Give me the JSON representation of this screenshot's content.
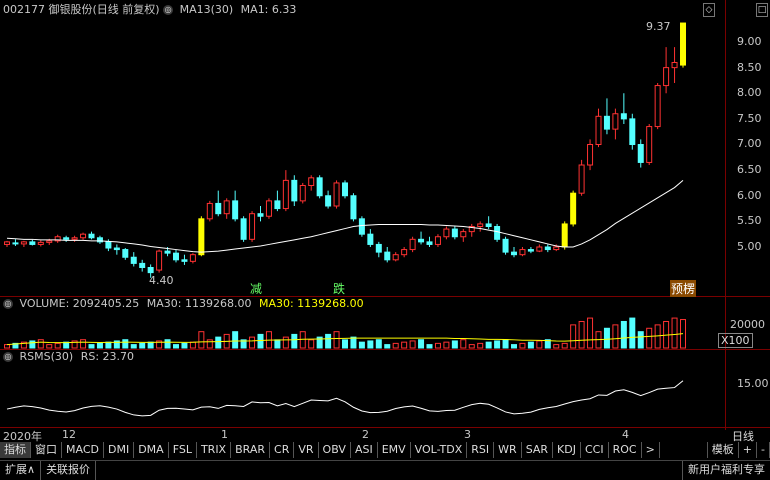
{
  "header": {
    "stock": "002177 御银股份(日线 前复权)",
    "ma_label": "MA13(30)",
    "ma_value": "MA1: 6.33",
    "volume_label": "VOLUME: 2092405.25",
    "ma30_a": "MA30: 1139268.00",
    "ma30_b": "MA30: 1139268.00",
    "rsms_label": "RSMS(30)",
    "rs_value": "RS: 23.70"
  },
  "price_axis": [
    "9.00",
    "8.50",
    "8.00",
    "7.50",
    "7.00",
    "6.50",
    "6.00",
    "5.50",
    "5.00"
  ],
  "volume_axis": {
    "tick": "20000",
    "unit": "X100"
  },
  "rsms_axis": {
    "tick": "15.00"
  },
  "annotations": {
    "high": "9.37",
    "low": "4.40",
    "tag1": "减",
    "tag2": "跌",
    "tag3": "预楞"
  },
  "date_axis": {
    "year": "2020年",
    "m12": "12",
    "m1": "1",
    "m2": "2",
    "m3": "3",
    "m4": "4",
    "period": "日线"
  },
  "tabs": [
    "指标",
    "窗口",
    "MACD",
    "DMI",
    "DMA",
    "FSL",
    "TRIX",
    "BRAR",
    "CR",
    "VR",
    "OBV",
    "ASI",
    "EMV",
    "VOL-TDX",
    "RSI",
    "WR",
    "SAR",
    "KDJ",
    "CCI",
    "ROC",
    ">",
    "模板",
    "+",
    "-"
  ],
  "bottom": {
    "expand": "扩展∧",
    "related": "关联报价",
    "promo": "新用户福利专享"
  },
  "colors": {
    "up": "#ff3232",
    "down": "#54ffff",
    "ma": "#ffffff",
    "accent": "#ffff00"
  },
  "chart_data": {
    "type": "candlestick",
    "title": "002177 御银股份(日线 前复权)",
    "ylim": [
      4.2,
      9.5
    ],
    "ohlc": [
      [
        5.05,
        5.12,
        5.0,
        5.1
      ],
      [
        5.08,
        5.15,
        5.02,
        5.06
      ],
      [
        5.06,
        5.12,
        5.0,
        5.1
      ],
      [
        5.1,
        5.14,
        5.03,
        5.05
      ],
      [
        5.05,
        5.13,
        5.01,
        5.09
      ],
      [
        5.09,
        5.16,
        5.04,
        5.12
      ],
      [
        5.12,
        5.24,
        5.08,
        5.2
      ],
      [
        5.18,
        5.22,
        5.1,
        5.15
      ],
      [
        5.15,
        5.22,
        5.1,
        5.18
      ],
      [
        5.18,
        5.28,
        5.14,
        5.25
      ],
      [
        5.25,
        5.3,
        5.15,
        5.18
      ],
      [
        5.18,
        5.22,
        5.06,
        5.1
      ],
      [
        5.1,
        5.15,
        4.92,
        4.98
      ],
      [
        4.98,
        5.05,
        4.85,
        4.95
      ],
      [
        4.95,
        4.98,
        4.75,
        4.8
      ],
      [
        4.8,
        4.9,
        4.62,
        4.68
      ],
      [
        4.68,
        4.75,
        4.52,
        4.6
      ],
      [
        4.6,
        4.66,
        4.4,
        4.5
      ],
      [
        4.55,
        4.95,
        4.5,
        4.92
      ],
      [
        4.92,
        5.0,
        4.82,
        4.88
      ],
      [
        4.88,
        4.95,
        4.7,
        4.75
      ],
      [
        4.75,
        4.85,
        4.65,
        4.72
      ],
      [
        4.72,
        4.88,
        4.68,
        4.85
      ],
      [
        4.85,
        5.6,
        4.82,
        5.55
      ],
      [
        5.55,
        5.9,
        5.5,
        5.85
      ],
      [
        5.85,
        6.1,
        5.6,
        5.65
      ],
      [
        5.65,
        5.95,
        5.55,
        5.9
      ],
      [
        5.9,
        6.1,
        5.5,
        5.55
      ],
      [
        5.55,
        5.6,
        5.1,
        5.15
      ],
      [
        5.15,
        5.7,
        5.1,
        5.65
      ],
      [
        5.65,
        5.8,
        5.5,
        5.6
      ],
      [
        5.6,
        5.95,
        5.55,
        5.9
      ],
      [
        5.9,
        6.1,
        5.7,
        5.75
      ],
      [
        5.75,
        6.5,
        5.7,
        6.3
      ],
      [
        6.3,
        6.4,
        5.8,
        5.9
      ],
      [
        5.9,
        6.25,
        5.85,
        6.2
      ],
      [
        6.2,
        6.4,
        6.1,
        6.35
      ],
      [
        6.35,
        6.4,
        5.95,
        6.0
      ],
      [
        6.0,
        6.1,
        5.75,
        5.8
      ],
      [
        5.8,
        6.3,
        5.75,
        6.25
      ],
      [
        6.25,
        6.3,
        5.95,
        6.0
      ],
      [
        6.0,
        6.05,
        5.5,
        5.55
      ],
      [
        5.55,
        5.6,
        5.2,
        5.25
      ],
      [
        5.25,
        5.35,
        5.0,
        5.05
      ],
      [
        5.05,
        5.1,
        4.8,
        4.9
      ],
      [
        4.9,
        5.0,
        4.7,
        4.75
      ],
      [
        4.75,
        4.9,
        4.72,
        4.85
      ],
      [
        4.85,
        5.0,
        4.8,
        4.95
      ],
      [
        4.95,
        5.2,
        4.9,
        5.15
      ],
      [
        5.15,
        5.3,
        5.05,
        5.1
      ],
      [
        5.1,
        5.2,
        5.0,
        5.05
      ],
      [
        5.05,
        5.25,
        5.0,
        5.2
      ],
      [
        5.2,
        5.4,
        5.15,
        5.35
      ],
      [
        5.35,
        5.4,
        5.15,
        5.2
      ],
      [
        5.2,
        5.35,
        5.1,
        5.3
      ],
      [
        5.3,
        5.45,
        5.2,
        5.4
      ],
      [
        5.4,
        5.5,
        5.3,
        5.45
      ],
      [
        5.45,
        5.6,
        5.35,
        5.4
      ],
      [
        5.4,
        5.45,
        5.1,
        5.15
      ],
      [
        5.15,
        5.2,
        4.85,
        4.9
      ],
      [
        4.9,
        5.0,
        4.8,
        4.85
      ],
      [
        4.85,
        5.0,
        4.82,
        4.95
      ],
      [
        4.95,
        5.0,
        4.88,
        4.92
      ],
      [
        4.92,
        5.05,
        4.9,
        5.0
      ],
      [
        5.0,
        5.05,
        4.9,
        4.95
      ],
      [
        4.95,
        5.05,
        4.92,
        5.0
      ],
      [
        5.0,
        5.5,
        4.95,
        5.45
      ],
      [
        5.45,
        6.1,
        5.4,
        6.05
      ],
      [
        6.05,
        6.7,
        6.0,
        6.6
      ],
      [
        6.6,
        7.1,
        6.5,
        7.0
      ],
      [
        7.0,
        7.7,
        6.95,
        7.55
      ],
      [
        7.55,
        7.9,
        7.2,
        7.3
      ],
      [
        7.3,
        7.7,
        7.1,
        7.6
      ],
      [
        7.6,
        8.0,
        7.4,
        7.5
      ],
      [
        7.5,
        7.6,
        6.9,
        7.0
      ],
      [
        7.0,
        7.1,
        6.55,
        6.65
      ],
      [
        6.65,
        7.4,
        6.6,
        7.35
      ],
      [
        7.35,
        8.2,
        7.3,
        8.15
      ],
      [
        8.15,
        8.9,
        8.0,
        8.5
      ],
      [
        8.5,
        8.9,
        8.2,
        8.6
      ],
      [
        8.55,
        9.37,
        8.5,
        9.37
      ]
    ],
    "ma": [
      5.17,
      5.16,
      5.15,
      5.15,
      5.14,
      5.14,
      5.14,
      5.13,
      5.13,
      5.13,
      5.12,
      5.12,
      5.11,
      5.1,
      5.08,
      5.06,
      5.04,
      5.01,
      4.99,
      4.97,
      4.95,
      4.93,
      4.91,
      4.9,
      4.91,
      4.92,
      4.94,
      4.96,
      4.98,
      5.0,
      5.02,
      5.05,
      5.08,
      5.11,
      5.14,
      5.17,
      5.2,
      5.24,
      5.28,
      5.32,
      5.36,
      5.4,
      5.42,
      5.43,
      5.44,
      5.44,
      5.44,
      5.44,
      5.44,
      5.44,
      5.43,
      5.43,
      5.42,
      5.41,
      5.4,
      5.38,
      5.36,
      5.33,
      5.3,
      5.26,
      5.22,
      5.18,
      5.14,
      5.1,
      5.06,
      5.02,
      5.0,
      5.0,
      5.06,
      5.14,
      5.24,
      5.34,
      5.46,
      5.56,
      5.66,
      5.76,
      5.86,
      5.96,
      6.06,
      6.16,
      6.3
    ],
    "volume": {
      "type": "bar",
      "ylim": [
        0,
        25000
      ],
      "last": 20924.05,
      "ma30": 11392.68
    },
    "rsms": {
      "type": "line",
      "ylim": [
        0,
        30
      ],
      "last": 23.7
    }
  }
}
